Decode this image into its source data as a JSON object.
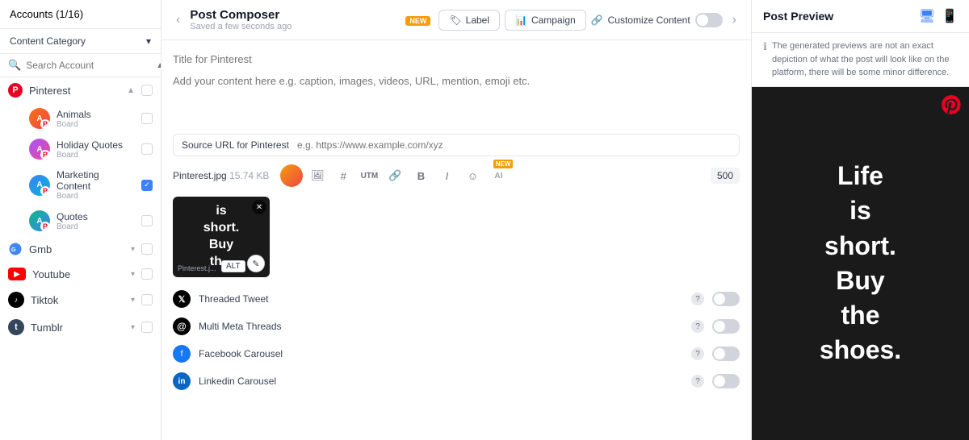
{
  "sidebar": {
    "header": "Accounts (1/16)",
    "content_category_label": "Content Category",
    "search_placeholder": "Search Account",
    "platforms": [
      {
        "name": "Pinterest",
        "icon_type": "pinterest",
        "expanded": true,
        "boards": [
          {
            "name": "Animals",
            "sub": "Board",
            "av_class": "av-animals"
          },
          {
            "name": "Holiday Quotes",
            "sub": "Board",
            "av_class": "av-holiday"
          },
          {
            "name": "Marketing Content",
            "sub": "Board",
            "av_class": "av-marketing",
            "checked": true
          },
          {
            "name": "Quotes",
            "sub": "Board",
            "av_class": "av-quotes"
          }
        ]
      },
      {
        "name": "Gmb",
        "icon_type": "gmb",
        "expanded": false,
        "boards": []
      },
      {
        "name": "Youtube",
        "icon_type": "youtube",
        "expanded": false,
        "boards": []
      },
      {
        "name": "Tiktok",
        "icon_type": "tiktok",
        "expanded": false,
        "boards": []
      },
      {
        "name": "Tumblr",
        "icon_type": "tumblr",
        "expanded": false,
        "boards": []
      }
    ]
  },
  "composer": {
    "title": "Post Composer",
    "saved_text": "Saved a few seconds ago",
    "new_badge": "NEW",
    "label_btn": "Label",
    "campaign_btn": "Campaign",
    "customize_label": "Customize Content",
    "title_placeholder": "Title for Pinterest",
    "content_placeholder": "Add your content here e.g. caption, images, videos, URL, mention, emoji etc.",
    "source_url_label": "Source URL for Pinterest",
    "source_url_placeholder": "e.g. https://www.example.com/xyz",
    "file_name": "Pinterest.jpg",
    "file_size": "15.74 KB",
    "char_count": "500",
    "image_text": "is\nshort.\nBuy\nth...",
    "options": [
      {
        "type": "x",
        "label": "Threaded Tweet",
        "icon_text": "𝕏"
      },
      {
        "type": "threads",
        "label": "Multi Meta Threads",
        "icon_text": "@"
      },
      {
        "type": "fb",
        "label": "Facebook Carousel",
        "icon_text": "f"
      },
      {
        "type": "li",
        "label": "Linkedin Carousel",
        "icon_text": "in"
      }
    ]
  },
  "preview": {
    "title": "Post Preview",
    "note": "The generated previews are not an exact depiction of what the post will look like on the platform, there will be some minor difference.",
    "image_text": "Life\nis\nshort.\nBuy\nthe\nshoes."
  }
}
